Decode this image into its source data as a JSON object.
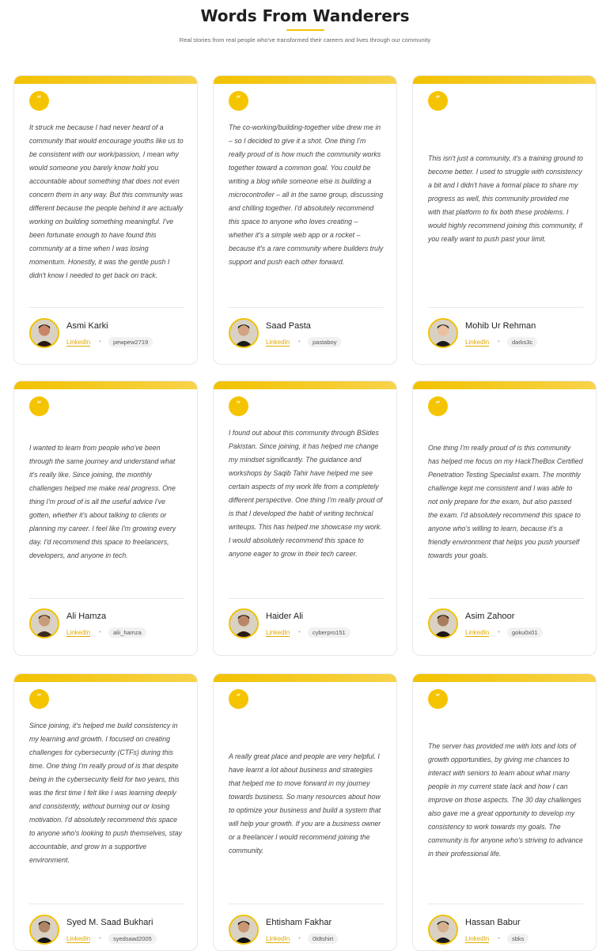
{
  "header": {
    "title": "Words From Wanderers",
    "subtitle": "Real stories from real people who've transformed their careers and lives through our community"
  },
  "colors": {
    "accent": "#f2c200",
    "link": "#e0a800"
  },
  "quote_icon": "“",
  "testimonials": [
    {
      "quote": "It struck me because I had never heard of a community that would encourage youths like us to be consistent with our work/passion, I mean why would someone you barely know hold you accountable about something that does not even concern them in any way. But this community was different because the people behind it are actually working on building something meaningful. I've been fortunate enough to have found this community at a time when I was losing momentum. Honestly, it was the gentle push I didn't know I needed to get back on track.",
      "name": "Asmi Karki",
      "link_label": "LinkedIn",
      "handle": "pewpew2719"
    },
    {
      "quote": "The co-working/building-together vibe drew me in – so I decided to give it a shot. One thing I'm really proud of is how much the community works together toward a common goal. You could be writing a blog while someone else is building a microcontroller – all in the same group, discussing and chilling together. I'd absolutely recommend this space to anyone who loves creating – whether it's a simple web app or a rocket – because it's a rare community where builders truly support and push each other forward.",
      "name": "Saad Pasta",
      "link_label": "LinkedIn",
      "handle": "pastaboy"
    },
    {
      "quote": "This isn't just a community, it's a training ground to become better. I used to struggle with consistency a bit and I didn't have a formal place to share my progress as well, this community provided me with that platform to fix both these problems. I would highly recommend joining this community, if you really want to push past your limit.",
      "name": "Mohib Ur Rehman",
      "link_label": "LinkedIn",
      "handle": "darks3c"
    },
    {
      "quote": "I wanted to learn from people who've been through the same journey and understand what it's really like. Since joining, the monthly challenges helped me make real progress. One thing I'm proud of is all the useful advice I've gotten, whether it's about talking to clients or planning my career. I feel like I'm growing every day. I'd recommend this space to freelancers, developers, and anyone in tech.",
      "name": "Ali Hamza",
      "link_label": "LinkedIn",
      "handle": "alii_hamza"
    },
    {
      "quote": "I found out about this community through BSides Pakistan. Since joining, it has helped me change my mindset significantly. The guidance and workshops by Saqib Tahir have helped me see certain aspects of my work life from a completely different perspective. One thing I'm really proud of is that I developed the habit of writing technical writeups. This has helped me showcase my work. I would absolutely recommend this space to anyone eager to grow in their tech career.",
      "name": "Haider Ali",
      "link_label": "LinkedIn",
      "handle": "cyberpro151"
    },
    {
      "quote": "One thing I'm really proud of is this community has helped me focus on my HackTheBox Certified Penetration Testing Specialist exam. The monthly challenge kept me consistent and I was able to not only prepare for the exam, but also passed the exam. I'd absolutely recommend this space to anyone who's willing to learn, because it's a friendly environment that helps you push yourself towards your goals.",
      "name": "Asim Zahoor",
      "link_label": "LinkedIn",
      "handle": "goku0x01"
    },
    {
      "quote": "Since joining, it's helped me build consistency in my learning and growth. I focused on creating challenges for cybersecurity (CTFs) during this time. One thing I'm really proud of is that despite being in the cybersecurity field for two years, this was the first time I felt like I was learning deeply and consistently, without burning out or losing motivation. I'd absolutely recommend this space to anyone who's looking to push themselves, stay accountable, and grow in a supportive environment.",
      "name": "Syed M. Saad Bukhari",
      "link_label": "LinkedIn",
      "handle": "syedsaad2005"
    },
    {
      "quote": "A really great place and people are very helpful. I have learnt a lot about business and strategies that helped me to move forward in my journey towards business. So many resources about how to optimize your business and build a system that will help your growth. If you are a business owner or a freelancer I would recommend joining the community.",
      "name": "Ehtisham Fakhar",
      "link_label": "LinkedIn",
      "handle": "0ldtshirt"
    },
    {
      "quote": "The server has provided me with lots and lots of growth opportunities, by giving me chances to interact with seniors to learn about what many people in my current state lack and how I can improve on those aspects. The 30 day challenges also gave me a great opportunity to develop my consistency to work towards my goals. The community is for anyone who's striving to advance in their professional life.",
      "name": "Hassan Babur",
      "link_label": "LinkedIn",
      "handle": "sbks"
    }
  ]
}
